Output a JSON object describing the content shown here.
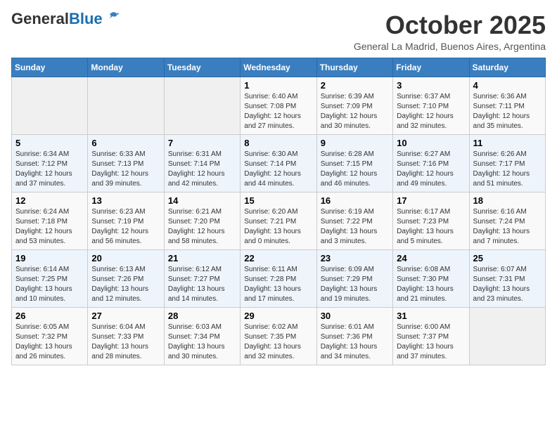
{
  "logo": {
    "part1": "General",
    "part2": "Blue"
  },
  "header": {
    "month": "October 2025",
    "location": "General La Madrid, Buenos Aires, Argentina"
  },
  "days_of_week": [
    "Sunday",
    "Monday",
    "Tuesday",
    "Wednesday",
    "Thursday",
    "Friday",
    "Saturday"
  ],
  "weeks": [
    [
      {
        "day": "",
        "info": ""
      },
      {
        "day": "",
        "info": ""
      },
      {
        "day": "",
        "info": ""
      },
      {
        "day": "1",
        "info": "Sunrise: 6:40 AM\nSunset: 7:08 PM\nDaylight: 12 hours\nand 27 minutes."
      },
      {
        "day": "2",
        "info": "Sunrise: 6:39 AM\nSunset: 7:09 PM\nDaylight: 12 hours\nand 30 minutes."
      },
      {
        "day": "3",
        "info": "Sunrise: 6:37 AM\nSunset: 7:10 PM\nDaylight: 12 hours\nand 32 minutes."
      },
      {
        "day": "4",
        "info": "Sunrise: 6:36 AM\nSunset: 7:11 PM\nDaylight: 12 hours\nand 35 minutes."
      }
    ],
    [
      {
        "day": "5",
        "info": "Sunrise: 6:34 AM\nSunset: 7:12 PM\nDaylight: 12 hours\nand 37 minutes."
      },
      {
        "day": "6",
        "info": "Sunrise: 6:33 AM\nSunset: 7:13 PM\nDaylight: 12 hours\nand 39 minutes."
      },
      {
        "day": "7",
        "info": "Sunrise: 6:31 AM\nSunset: 7:14 PM\nDaylight: 12 hours\nand 42 minutes."
      },
      {
        "day": "8",
        "info": "Sunrise: 6:30 AM\nSunset: 7:14 PM\nDaylight: 12 hours\nand 44 minutes."
      },
      {
        "day": "9",
        "info": "Sunrise: 6:28 AM\nSunset: 7:15 PM\nDaylight: 12 hours\nand 46 minutes."
      },
      {
        "day": "10",
        "info": "Sunrise: 6:27 AM\nSunset: 7:16 PM\nDaylight: 12 hours\nand 49 minutes."
      },
      {
        "day": "11",
        "info": "Sunrise: 6:26 AM\nSunset: 7:17 PM\nDaylight: 12 hours\nand 51 minutes."
      }
    ],
    [
      {
        "day": "12",
        "info": "Sunrise: 6:24 AM\nSunset: 7:18 PM\nDaylight: 12 hours\nand 53 minutes."
      },
      {
        "day": "13",
        "info": "Sunrise: 6:23 AM\nSunset: 7:19 PM\nDaylight: 12 hours\nand 56 minutes."
      },
      {
        "day": "14",
        "info": "Sunrise: 6:21 AM\nSunset: 7:20 PM\nDaylight: 12 hours\nand 58 minutes."
      },
      {
        "day": "15",
        "info": "Sunrise: 6:20 AM\nSunset: 7:21 PM\nDaylight: 13 hours\nand 0 minutes."
      },
      {
        "day": "16",
        "info": "Sunrise: 6:19 AM\nSunset: 7:22 PM\nDaylight: 13 hours\nand 3 minutes."
      },
      {
        "day": "17",
        "info": "Sunrise: 6:17 AM\nSunset: 7:23 PM\nDaylight: 13 hours\nand 5 minutes."
      },
      {
        "day": "18",
        "info": "Sunrise: 6:16 AM\nSunset: 7:24 PM\nDaylight: 13 hours\nand 7 minutes."
      }
    ],
    [
      {
        "day": "19",
        "info": "Sunrise: 6:14 AM\nSunset: 7:25 PM\nDaylight: 13 hours\nand 10 minutes."
      },
      {
        "day": "20",
        "info": "Sunrise: 6:13 AM\nSunset: 7:26 PM\nDaylight: 13 hours\nand 12 minutes."
      },
      {
        "day": "21",
        "info": "Sunrise: 6:12 AM\nSunset: 7:27 PM\nDaylight: 13 hours\nand 14 minutes."
      },
      {
        "day": "22",
        "info": "Sunrise: 6:11 AM\nSunset: 7:28 PM\nDaylight: 13 hours\nand 17 minutes."
      },
      {
        "day": "23",
        "info": "Sunrise: 6:09 AM\nSunset: 7:29 PM\nDaylight: 13 hours\nand 19 minutes."
      },
      {
        "day": "24",
        "info": "Sunrise: 6:08 AM\nSunset: 7:30 PM\nDaylight: 13 hours\nand 21 minutes."
      },
      {
        "day": "25",
        "info": "Sunrise: 6:07 AM\nSunset: 7:31 PM\nDaylight: 13 hours\nand 23 minutes."
      }
    ],
    [
      {
        "day": "26",
        "info": "Sunrise: 6:05 AM\nSunset: 7:32 PM\nDaylight: 13 hours\nand 26 minutes."
      },
      {
        "day": "27",
        "info": "Sunrise: 6:04 AM\nSunset: 7:33 PM\nDaylight: 13 hours\nand 28 minutes."
      },
      {
        "day": "28",
        "info": "Sunrise: 6:03 AM\nSunset: 7:34 PM\nDaylight: 13 hours\nand 30 minutes."
      },
      {
        "day": "29",
        "info": "Sunrise: 6:02 AM\nSunset: 7:35 PM\nDaylight: 13 hours\nand 32 minutes."
      },
      {
        "day": "30",
        "info": "Sunrise: 6:01 AM\nSunset: 7:36 PM\nDaylight: 13 hours\nand 34 minutes."
      },
      {
        "day": "31",
        "info": "Sunrise: 6:00 AM\nSunset: 7:37 PM\nDaylight: 13 hours\nand 37 minutes."
      },
      {
        "day": "",
        "info": ""
      }
    ]
  ]
}
